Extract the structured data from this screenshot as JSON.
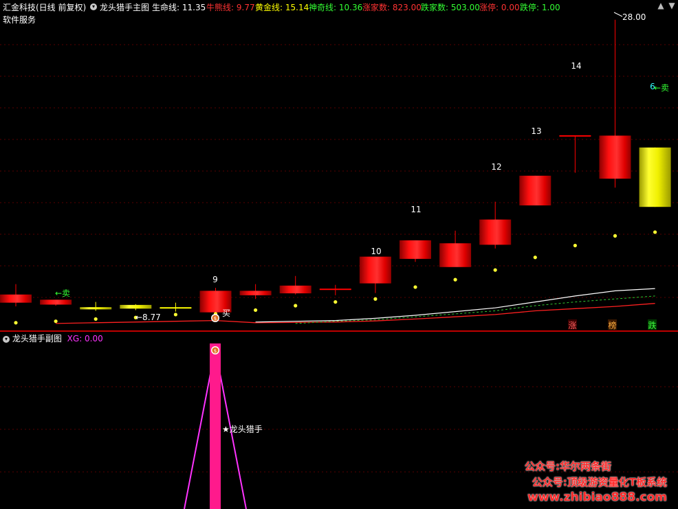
{
  "main_header": {
    "stock": "汇金科技(日线 前复权)",
    "indicator_name": "龙头猎手主图",
    "sub_label": "软件服务",
    "lines": [
      {
        "label": "生命线:",
        "value": "11.35",
        "color": "#ffffff"
      },
      {
        "label": "牛熊线:",
        "value": "9.77",
        "color": "#ff3333"
      },
      {
        "label": "黄金线:",
        "value": "15.14",
        "color": "#ffff00"
      },
      {
        "label": "神奇线:",
        "value": "10.36",
        "color": "#33ff33"
      },
      {
        "label": "涨家数:",
        "value": "823.00",
        "color": "#ff3333"
      },
      {
        "label": "跌家数:",
        "value": "503.00",
        "color": "#33ff33"
      },
      {
        "label": "涨停:",
        "value": "0.00",
        "color": "#ff3333"
      },
      {
        "label": "跌停:",
        "value": "1.00",
        "color": "#33ff33"
      }
    ]
  },
  "window_buttons": {
    "up": "▲",
    "down": "▼"
  },
  "chart_data": {
    "type": "candlestick",
    "price_range": [
      7.5,
      28.5
    ],
    "candles": [
      {
        "o": 9.5,
        "h": 10.2,
        "l": 8.7,
        "c": 8.95,
        "color": "red"
      },
      {
        "o": 9.15,
        "h": 9.15,
        "l": 8.75,
        "c": 8.82,
        "color": "red"
      },
      {
        "o": 8.65,
        "h": 9.0,
        "l": 8.4,
        "c": 8.5,
        "color": "yellow"
      },
      {
        "o": 8.8,
        "h": 8.85,
        "l": 8.45,
        "c": 8.55,
        "color": "yellow"
      },
      {
        "o": 8.6,
        "h": 8.95,
        "l": 8.35,
        "c": 8.55,
        "color": "yellow"
      },
      {
        "o": 9.75,
        "h": 9.95,
        "l": 8.3,
        "c": 8.3,
        "color": "red"
      },
      {
        "o": 9.75,
        "h": 10.2,
        "l": 9.2,
        "c": 9.45,
        "color": "red"
      },
      {
        "o": 10.1,
        "h": 10.75,
        "l": 9.5,
        "c": 9.58,
        "color": "red"
      },
      {
        "o": 9.85,
        "h": 10.15,
        "l": 9.45,
        "c": 9.8,
        "color": "red"
      },
      {
        "o": 12.05,
        "h": 12.05,
        "l": 9.6,
        "c": 10.25,
        "color": "red"
      },
      {
        "o": 13.15,
        "h": 13.15,
        "l": 11.7,
        "c": 11.9,
        "color": "red"
      },
      {
        "o": 12.95,
        "h": 13.8,
        "l": 11.4,
        "c": 11.35,
        "color": "red"
      },
      {
        "o": 14.55,
        "h": 15.75,
        "l": 12.6,
        "c": 12.85,
        "color": "red"
      },
      {
        "o": 17.5,
        "h": 17.5,
        "l": 15.5,
        "c": 15.5,
        "color": "red"
      },
      {
        "o": 20.18,
        "h": 20.18,
        "l": 17.7,
        "c": 20.18,
        "color": "red"
      },
      {
        "o": 20.2,
        "h": 28.0,
        "l": 16.7,
        "c": 17.3,
        "color": "red"
      },
      {
        "o": 19.4,
        "h": 19.4,
        "l": 15.4,
        "c": 15.4,
        "color": "yellow"
      }
    ],
    "yellow_dots": [
      7.6,
      7.7,
      7.85,
      7.95,
      8.15,
      8.2,
      8.45,
      8.75,
      9.0,
      9.2,
      10.0,
      10.5,
      11.15,
      12.0,
      12.8,
      13.45,
      13.7
    ],
    "white_line": [
      null,
      null,
      null,
      null,
      null,
      null,
      7.65,
      7.7,
      7.75,
      7.9,
      8.1,
      8.35,
      8.6,
      9.0,
      9.4,
      9.75,
      9.9
    ],
    "green_line": [
      null,
      null,
      null,
      null,
      null,
      null,
      null,
      7.55,
      7.7,
      7.8,
      8.0,
      8.2,
      8.4,
      8.75,
      9.0,
      9.2,
      9.4
    ],
    "red_line": [
      null,
      7.55,
      7.6,
      7.65,
      7.7,
      7.75,
      7.6,
      7.62,
      7.65,
      7.72,
      7.85,
      8.0,
      8.15,
      8.4,
      8.55,
      8.7,
      8.9
    ]
  },
  "annotations": {
    "sell_1": "←卖",
    "sell_2": "←卖",
    "buy": "买",
    "low_price": "←8.77",
    "high_price": "28.00",
    "count_9": "9",
    "count_10": "10",
    "count_11": "11",
    "count_12": "12",
    "count_13": "13",
    "count_14": "14",
    "count_6": "6",
    "zhang": "涨",
    "bang": "榜",
    "die": "跌"
  },
  "sub_header": {
    "title": "龙头猎手副图",
    "xg_label": "XG: 0.00"
  },
  "sub_chart": {
    "hunter_label": "★龙头猎手"
  },
  "watermarks": {
    "line1": "公众号:华尔两条街",
    "line2": "公众号:顶级游资量化T板系统",
    "line3": "www.zhibiao888.com"
  },
  "colors": {
    "up": "#ff0000",
    "yellow": "#ffff00",
    "magenta": "#ff1a8c",
    "grid": "#5a0000",
    "divider": "#c00000"
  }
}
